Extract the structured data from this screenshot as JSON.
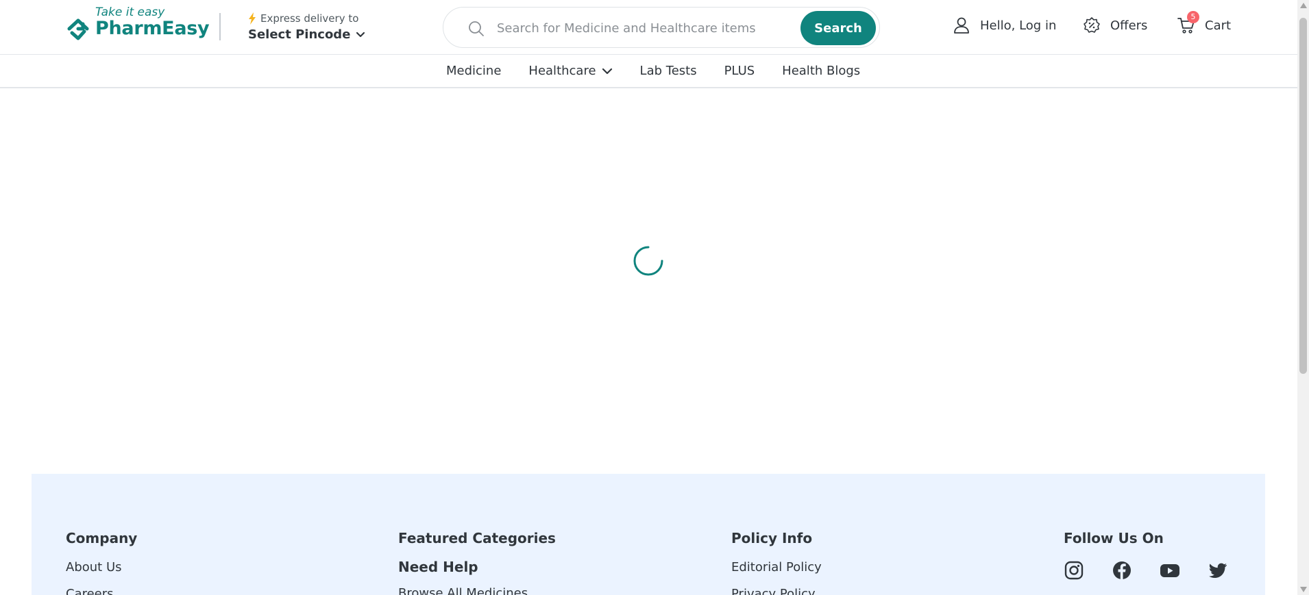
{
  "brand": {
    "tagline": "Take it easy",
    "name": "PharmEasy",
    "color": "#10847e"
  },
  "delivery": {
    "label": "Express delivery to",
    "pincode": "Select Pincode"
  },
  "search": {
    "placeholder": "Search for Medicine and Healthcare items",
    "button": "Search"
  },
  "header_actions": {
    "login": "Hello, Log in",
    "offers": "Offers",
    "cart": "Cart",
    "cart_count": "5"
  },
  "nav": {
    "items": [
      {
        "label": "Medicine"
      },
      {
        "label": "Healthcare",
        "has_dropdown": true
      },
      {
        "label": "Lab Tests"
      },
      {
        "label": "PLUS"
      },
      {
        "label": "Health Blogs"
      }
    ]
  },
  "footer": {
    "company": {
      "heading": "Company",
      "links": [
        "About Us",
        "Careers"
      ]
    },
    "featured": {
      "heading": "Featured Categories",
      "help_heading": "Need Help",
      "help_links": [
        "Browse All Medicines"
      ]
    },
    "policy": {
      "heading": "Policy Info",
      "links": [
        "Editorial Policy",
        "Privacy Policy"
      ]
    },
    "follow": {
      "heading": "Follow Us On",
      "icons": [
        "instagram-icon",
        "facebook-icon",
        "youtube-icon",
        "twitter-icon"
      ]
    }
  }
}
